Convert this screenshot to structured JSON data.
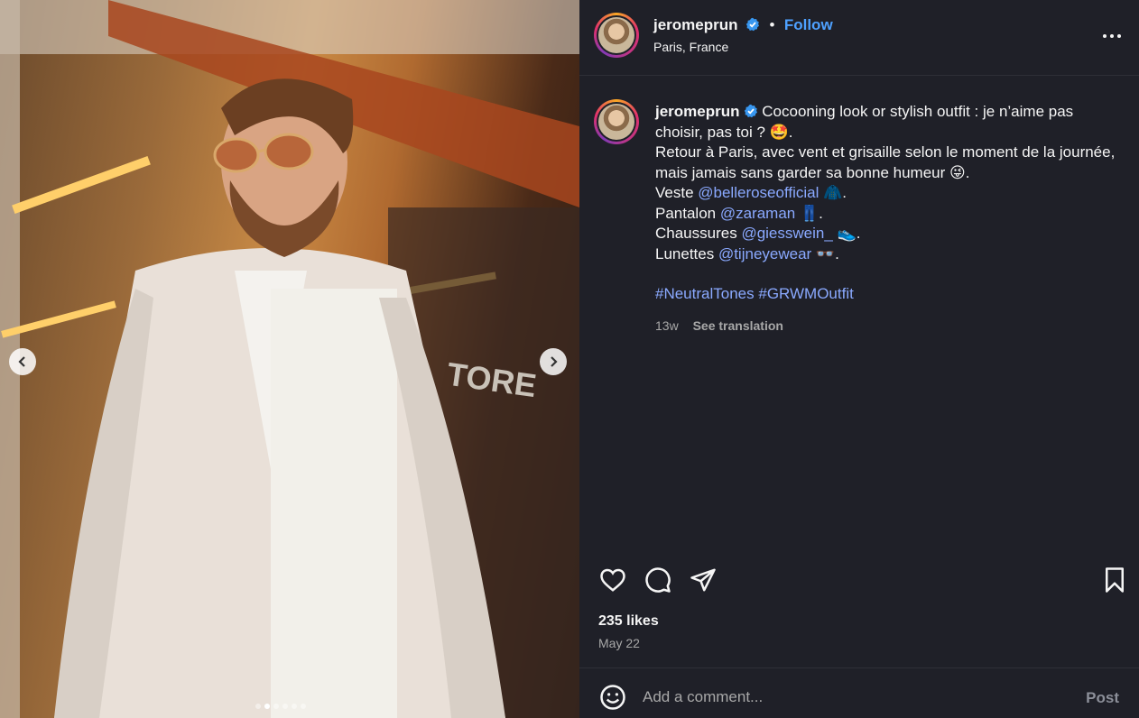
{
  "post": {
    "username": "jeromeprun",
    "follow_label": "Follow",
    "location": "Paris, France",
    "separator": "•"
  },
  "caption": {
    "username": "jeromeprun",
    "line1": "Cocooning look or stylish outfit : je n’aime pas choisir, pas toi ? 🤩.",
    "line2": "Retour à Paris, avec vent et grisaille selon le moment de la journée, mais jamais sans garder sa bonne humeur 😜.",
    "veste_label": "Veste ",
    "veste_mention": "@belleroseofficial",
    "veste_emoji": " 🧥.",
    "pantalon_label": "Pantalon ",
    "pantalon_mention": "@zaraman",
    "pantalon_emoji": " 👖.",
    "chaussures_label": "Chaussures ",
    "chaussures_mention": "@giesswein_",
    "chaussures_emoji": " 👟.",
    "lunettes_label": "Lunettes ",
    "lunettes_mention": "@tijneyewear",
    "lunettes_emoji": " 👓.",
    "hashtag1": "#NeutralTones",
    "hashtag2": "#GRWMOutfit",
    "age": "13w",
    "see_translation": "See translation"
  },
  "engagement": {
    "likes": "235 likes",
    "date": "May 22"
  },
  "comment": {
    "placeholder": "Add a comment...",
    "post_label": "Post"
  },
  "carousel": {
    "slide_count": 6,
    "active_index": 1
  },
  "colors": {
    "background": "#1f2028",
    "link": "#4ea1ff",
    "mention": "#8aa9ff",
    "verified": "#3897f0"
  }
}
